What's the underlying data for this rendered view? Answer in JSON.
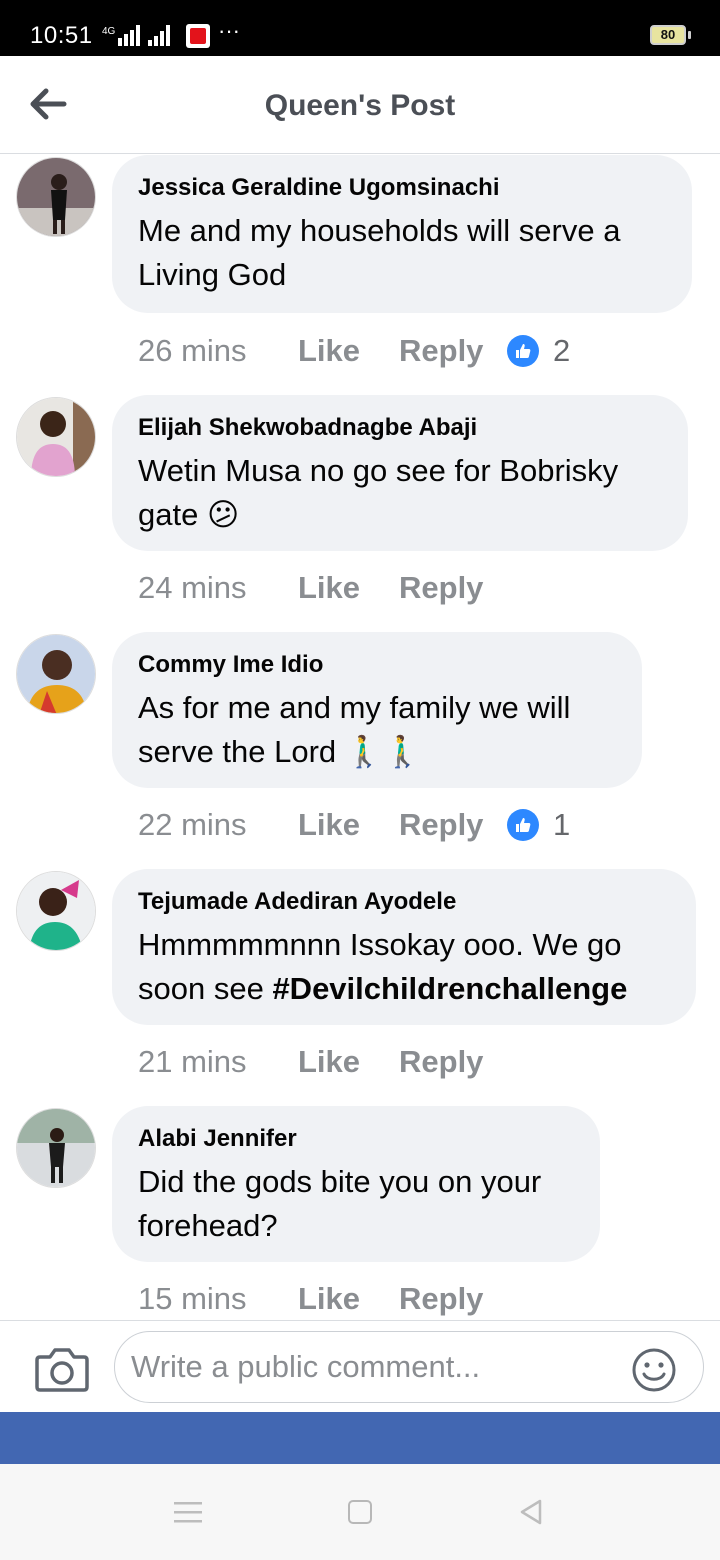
{
  "status_bar": {
    "time": "10:51",
    "more": "···",
    "battery": "80"
  },
  "header": {
    "title": "Queen's Post",
    "back_icon": "arrow-left-icon"
  },
  "comments": [
    {
      "author": "Jessica Geraldine Ugomsinachi",
      "text": "Me and my households will serve a Living God",
      "time": "26 mins",
      "like_label": "Like",
      "reply_label": "Reply",
      "reactions": "2"
    },
    {
      "author": "Elijah Shekwobadnagbe Abaji",
      "text": "Wetin Musa no go see for Bobrisky gate 😕",
      "time": "24 mins",
      "like_label": "Like",
      "reply_label": "Reply"
    },
    {
      "author": "Commy Ime Idio",
      "text": "As for me and my family we will serve the Lord 🚶‍♂️🚶‍♂️",
      "time": "22 mins",
      "like_label": "Like",
      "reply_label": "Reply",
      "reactions": "1"
    },
    {
      "author": "Tejumade Adediran Ayodele",
      "text_plain": "Hmmmmmnnn Issokay ooo. We go soon see ",
      "hashtag": "#Devilchildrenchallenge",
      "time": "21 mins",
      "like_label": "Like",
      "reply_label": "Reply"
    },
    {
      "author": "Alabi Jennifer",
      "text": "Did the gods bite you on your forehead?",
      "time": "15 mins",
      "like_label": "Like",
      "reply_label": "Reply"
    }
  ],
  "composer": {
    "placeholder": "Write a public comment..."
  },
  "icons": {
    "camera": "camera-icon",
    "emoji": "smiley-icon",
    "like_badge": "thumbs-up-icon"
  },
  "colors": {
    "bubble": "#f0f2f5",
    "meta": "#8a8d91",
    "like_blue": "#2d88ff",
    "fb_bar": "#4267b2"
  }
}
